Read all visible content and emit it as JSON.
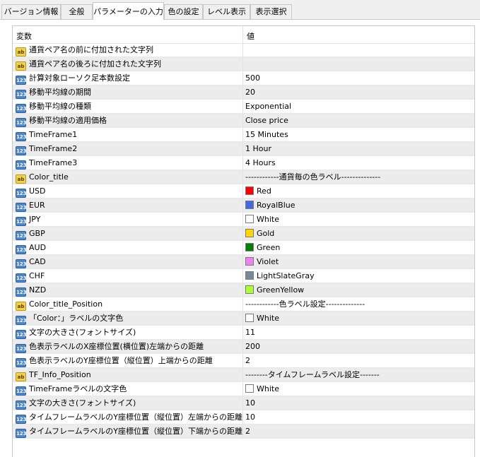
{
  "tabs": [
    {
      "label": "バージョン情報",
      "active": false
    },
    {
      "label": "全般",
      "active": false
    },
    {
      "label": "パラメーターの入力",
      "active": true
    },
    {
      "label": "色の設定",
      "active": false
    },
    {
      "label": "レベル表示",
      "active": false
    },
    {
      "label": "表示選択",
      "active": false
    }
  ],
  "grid": {
    "header": {
      "name": "変数",
      "value": "値"
    },
    "rows": [
      {
        "icon": "ab",
        "name": "通貨ペア名の前に付加された文字列",
        "value": ""
      },
      {
        "icon": "ab",
        "name": "通貨ペア名の後ろに付加された文字列",
        "value": ""
      },
      {
        "icon": "num",
        "name": "計算対象ローソク足本数設定",
        "value": "500"
      },
      {
        "icon": "num",
        "name": "移動平均線の期間",
        "value": "20"
      },
      {
        "icon": "num",
        "name": "移動平均線の種類",
        "value": "Exponential"
      },
      {
        "icon": "num",
        "name": "移動平均線の適用価格",
        "value": "Close price"
      },
      {
        "icon": "num",
        "name": "TimeFrame1",
        "value": "15 Minutes"
      },
      {
        "icon": "num",
        "name": "TimeFrame2",
        "value": "1 Hour"
      },
      {
        "icon": "num",
        "name": "TimeFrame3",
        "value": "4 Hours"
      },
      {
        "icon": "ab",
        "name": "Color_title",
        "value": "------------通貨毎の色ラベル--------------"
      },
      {
        "icon": "num",
        "name": "USD",
        "value": "Red",
        "color": "#ff0000"
      },
      {
        "icon": "num",
        "name": "EUR",
        "value": "RoyalBlue",
        "color": "#4169e1"
      },
      {
        "icon": "num",
        "name": "JPY",
        "value": "White",
        "color": "#ffffff"
      },
      {
        "icon": "num",
        "name": "GBP",
        "value": "Gold",
        "color": "#ffd700"
      },
      {
        "icon": "num",
        "name": "AUD",
        "value": "Green",
        "color": "#008000"
      },
      {
        "icon": "num",
        "name": "CAD",
        "value": "Violet",
        "color": "#ee82ee"
      },
      {
        "icon": "num",
        "name": "CHF",
        "value": "LightSlateGray",
        "color": "#778899"
      },
      {
        "icon": "num",
        "name": "NZD",
        "value": "GreenYellow",
        "color": "#adff2f"
      },
      {
        "icon": "ab",
        "name": "Color_title_Position",
        "value": "------------色ラベル設定--------------"
      },
      {
        "icon": "num",
        "name": "「Color：」ラベルの文字色",
        "value": "White",
        "color": "#ffffff"
      },
      {
        "icon": "num",
        "name": "文字の大きさ(フォントサイズ)",
        "value": "11"
      },
      {
        "icon": "num",
        "name": "色表示ラベルのX座標位置(横位置)左端からの距離",
        "value": "200"
      },
      {
        "icon": "num",
        "name": "色表示ラベルのY座標位置（縦位置）上端からの距離",
        "value": "2"
      },
      {
        "icon": "ab",
        "name": "TF_Info_Position",
        "value": "--------タイムフレームラベル設定-------"
      },
      {
        "icon": "num",
        "name": "TimeFrameラベルの文字色",
        "value": "White",
        "color": "#ffffff"
      },
      {
        "icon": "num",
        "name": "文字の大きさ(フォントサイズ)",
        "value": "10"
      },
      {
        "icon": "num",
        "name": "タイムフレームラベルのY座標位置（縦位置）左端からの距離",
        "value": "10"
      },
      {
        "icon": "num",
        "name": "タイムフレームラベルのY座標位置（縦位置）下端からの距離",
        "value": "2"
      }
    ]
  }
}
